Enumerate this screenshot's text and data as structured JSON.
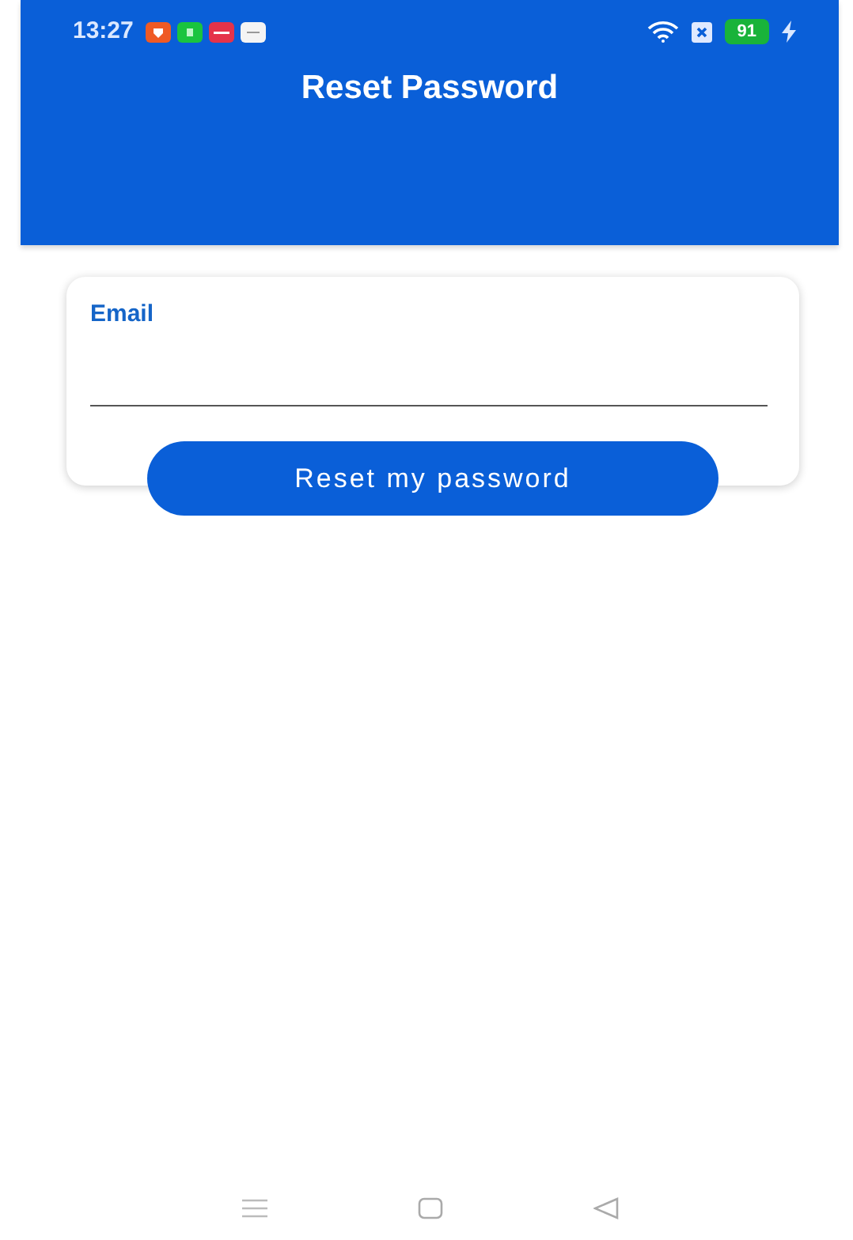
{
  "status_bar": {
    "time": "13:27",
    "battery": "91"
  },
  "header": {
    "title": "Reset Password"
  },
  "form": {
    "field_label": "Email"
  },
  "button": "Reset my password"
}
